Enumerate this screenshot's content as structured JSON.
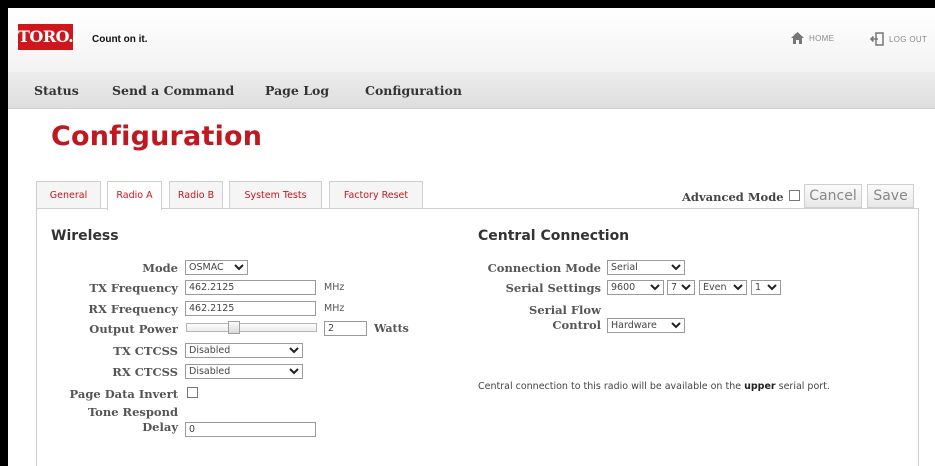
{
  "header": {
    "logo_text": "TORO.",
    "tagline": "Count on it.",
    "home_label": "HOME",
    "logout_label": "LOG OUT",
    "brand_color": "#d0161d"
  },
  "nav": {
    "items": [
      {
        "label": "Status"
      },
      {
        "label": "Send a Command"
      },
      {
        "label": "Page Log"
      },
      {
        "label": "Configuration"
      }
    ]
  },
  "page": {
    "title": "Configuration",
    "title_color": "#c01820"
  },
  "tabs": [
    {
      "label": "General",
      "active": false
    },
    {
      "label": "Radio A",
      "active": true
    },
    {
      "label": "Radio B",
      "active": false
    },
    {
      "label": "System Tests",
      "active": false
    },
    {
      "label": "Factory Reset",
      "active": false
    }
  ],
  "toolbar": {
    "advanced_mode_label": "Advanced Mode",
    "advanced_mode_checked": false,
    "cancel_label": "Cancel",
    "save_label": "Save"
  },
  "wireless": {
    "title": "Wireless",
    "mode_label": "Mode",
    "mode_value": "OSMAC",
    "tx_frequency_label": "TX Frequency",
    "tx_frequency_value": "462.2125",
    "tx_frequency_unit": "MHz",
    "rx_frequency_label": "RX Frequency",
    "rx_frequency_value": "462.2125",
    "rx_frequency_unit": "MHz",
    "output_power_label": "Output Power",
    "output_power_value": "2",
    "output_power_unit": "Watts",
    "output_power_slider_fraction": 0.35,
    "tx_ctcss_label": "TX CTCSS",
    "tx_ctcss_value": "Disabled",
    "rx_ctcss_label": "RX CTCSS",
    "rx_ctcss_value": "Disabled",
    "page_data_invert_label": "Page Data Invert",
    "page_data_invert_checked": false,
    "tone_respond_delay_label_1": "Tone Respond",
    "tone_respond_delay_label_2": "Delay",
    "tone_respond_delay_value": "0"
  },
  "central": {
    "title": "Central Connection",
    "connection_mode_label": "Connection Mode",
    "connection_mode_value": "Serial",
    "serial_settings_label": "Serial Settings",
    "baud_value": "9600",
    "data_bits_value": "7",
    "parity_value": "Even",
    "stop_bits_value": "1",
    "serial_flow_label_1": "Serial Flow",
    "serial_flow_label_2": "Control",
    "serial_flow_value": "Hardware",
    "note_prefix": "Central connection to this radio will be available on the ",
    "note_bold": "upper",
    "note_suffix": " serial port."
  }
}
